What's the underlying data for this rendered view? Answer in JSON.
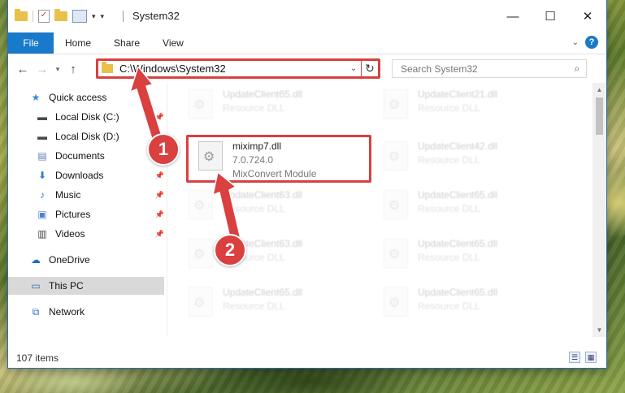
{
  "window": {
    "title": "System32",
    "quick_access_arrow": "▾"
  },
  "ribbon": {
    "tabs": [
      "File",
      "Home",
      "Share",
      "View"
    ],
    "help": "?"
  },
  "address": {
    "path": "C:\\Windows\\System32",
    "refresh": "↻",
    "search_placeholder": "Search System32"
  },
  "navigation": {
    "items": [
      {
        "label": "Quick access",
        "icon": "star-icon",
        "pinned": false
      },
      {
        "label": "Local Disk (C:)",
        "icon": "drive-icon",
        "pinned": true
      },
      {
        "label": "Local Disk (D:)",
        "icon": "drive-icon",
        "pinned": false
      },
      {
        "label": "Documents",
        "icon": "documents-icon",
        "pinned": true
      },
      {
        "label": "Downloads",
        "icon": "download-icon",
        "pinned": true
      },
      {
        "label": "Music",
        "icon": "music-icon",
        "pinned": true
      },
      {
        "label": "Pictures",
        "icon": "pictures-icon",
        "pinned": true
      },
      {
        "label": "Videos",
        "icon": "videos-icon",
        "pinned": true
      },
      {
        "label": "OneDrive",
        "icon": "cloud-icon",
        "pinned": false
      },
      {
        "label": "This PC",
        "icon": "computer-icon",
        "pinned": false,
        "selected": true
      },
      {
        "label": "Network",
        "icon": "network-icon",
        "pinned": false
      }
    ]
  },
  "files": [
    {
      "name": "UpdateClient65.dll",
      "type": "Resource DLL"
    },
    {
      "name": "UpdateClient21.dll",
      "type": "Resource DLL"
    },
    {
      "name": "miximp7.dll",
      "version": "7.0.724.0",
      "description": "MixConvert Module"
    },
    {
      "name": "UpdateClient42.dll",
      "type": "Resource DLL"
    },
    {
      "name": "UpdateClient63.dll",
      "type": "Resource DLL"
    },
    {
      "name": "UpdateClient65.dll",
      "type": "Resource DLL"
    },
    {
      "name": "UpdateClient63.dll",
      "type": "Resource DLL"
    },
    {
      "name": "UpdateClient65.dll",
      "type": "Resource DLL"
    },
    {
      "name": "UpdateClient65.dll",
      "type": "Resource DLL"
    },
    {
      "name": "UpdateClient65.dll",
      "type": "Resource DLL"
    }
  ],
  "status": {
    "item_count": "107 items"
  },
  "annotations": {
    "step1": "1",
    "step2": "2",
    "color": "#d9403f"
  }
}
